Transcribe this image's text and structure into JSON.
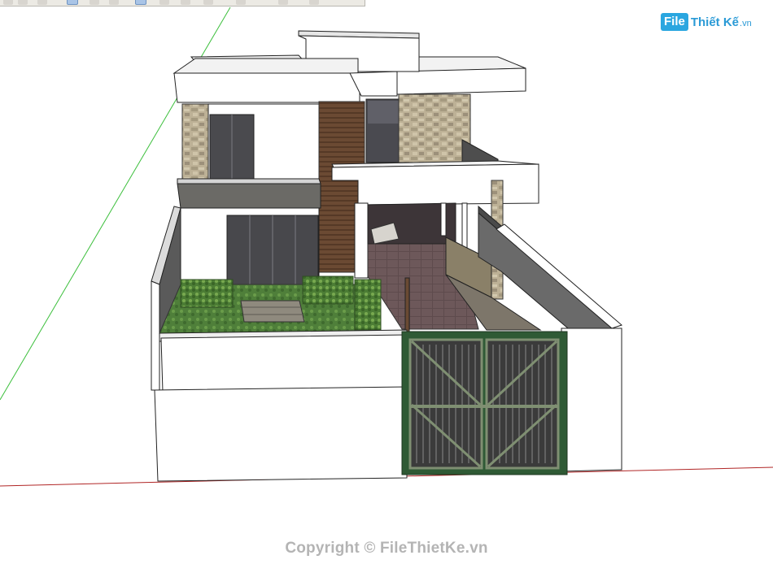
{
  "toolbar": {
    "buttons": [
      {
        "icon": "select-arrow-icon",
        "active": false
      },
      {
        "icon": "undo-icon",
        "active": false
      },
      {
        "icon": "paint-bucket-icon",
        "active": false
      },
      {
        "icon": "orbit-icon",
        "active": true
      },
      {
        "icon": "pan-icon",
        "active": false
      },
      {
        "icon": "zoom-icon",
        "active": false
      },
      {
        "icon": "zoom-window-icon",
        "active": true
      },
      {
        "icon": "zoom-extents-icon",
        "active": false
      },
      {
        "icon": "previous-view-icon",
        "active": false
      },
      {
        "icon": "walk-icon",
        "active": false
      },
      {
        "icon": "look-around-icon",
        "active": false
      },
      {
        "icon": "section-plane-icon",
        "active": false
      },
      {
        "icon": "position-camera-icon",
        "active": false
      }
    ]
  },
  "logo": {
    "badge": "File",
    "text1": "Thiết Kế",
    "text2": ".vn"
  },
  "watermark": "Copyright © FileThietKe.vn",
  "colors": {
    "green_axis": "#2fb52f",
    "red_axis": "#b22020",
    "gate_frame": "#2f5a35",
    "wall": "#ffffff",
    "stone": "#b9ad94"
  }
}
